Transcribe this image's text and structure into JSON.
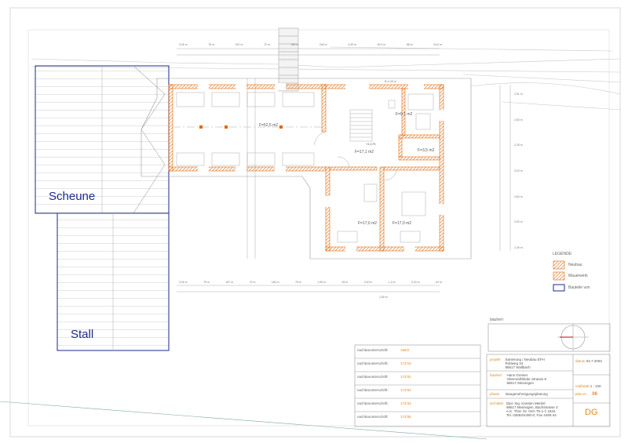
{
  "buildings": {
    "scheune": "Scheune",
    "stall": "Stall"
  },
  "rooms": {
    "hall": "F=52,5 m2",
    "bath": "F=9,1 m2",
    "stair": "F=17,1 m2",
    "room_left": "F=17,0 m2",
    "room_right": "F=17,0 m2",
    "wc": "F=3,5 m2",
    "level": "+4,175"
  },
  "legend": {
    "title": "LEGENDE:",
    "items": [
      {
        "label": "Neubau",
        "color": "#f4a455"
      },
      {
        "label": "Mauerwerk",
        "color": "#f4a455"
      },
      {
        "label": "Bauteile von",
        "color": "#1a2a8a"
      }
    ]
  },
  "bauherr_box": {
    "label": "bauherr"
  },
  "signatures": [
    {
      "label": "nachbarunterschrift:",
      "value": "158/2"
    },
    {
      "label": "nachbarunterschrift:",
      "value": "172/16"
    },
    {
      "label": "nachbarunterschrift:",
      "value": "172/31"
    },
    {
      "label": "nachbarunterschrift:",
      "value": "172/32"
    },
    {
      "label": "nachbarunterschrift:",
      "value": "172/33"
    },
    {
      "label": "nachbarunterschrift:",
      "value": "172/35"
    }
  ],
  "title_block": {
    "projekt_label": "projekt",
    "projekt_lines": [
      "Sanierung / Neubau EFH",
      "Rottweg 34",
      "98617 Wallbach"
    ],
    "bauherr_label": "bauherr",
    "bauherr_lines": [
      "Hans Greiner",
      "Obermaßfelder Strasse 8",
      "98617 Meiningen"
    ],
    "phase_label": "phase",
    "phase_value": "Baugenehmigungsplanung",
    "architekt_label": "architekt",
    "architekt_lines": [
      "Dipl.-Ing. Karsten Merkel",
      "98617 Meiningen, Bachstrasse 3",
      "A.K. Thür. Nr. 0VA-Th-1-1 1834",
      "Tel. 03693/4490-0, Fax 4490-44"
    ],
    "datum_label": "datum",
    "datum_value": "04.7.2003",
    "massstab_label": "maßstab",
    "massstab_value": "1 : 100",
    "plan_label": "plan-nr",
    "plan_value": "06",
    "sheet_code": "DG"
  },
  "dims": {
    "top_row": [
      "3,26 m",
      "75 m",
      "187 m",
      "72 m",
      "180 m",
      "240 m",
      "4,39 m",
      "90,0 m",
      "88 m",
      "24,6 m"
    ],
    "bottom_row": [
      "3,26 m",
      "75 m",
      "187 m",
      "72 m",
      "180 m",
      "75 m",
      "1,95 m",
      "28 m",
      "3,20 m",
      "1,2 m",
      "3,20 m",
      "62 m"
    ],
    "right_col": [
      "2,51 m",
      "2,60 m",
      "2,28 m",
      "3,03 m",
      "4,84 m",
      "3,00 m",
      "2,49 m"
    ],
    "total_width": "1,50 m",
    "top_note": "B=2,45 m"
  }
}
